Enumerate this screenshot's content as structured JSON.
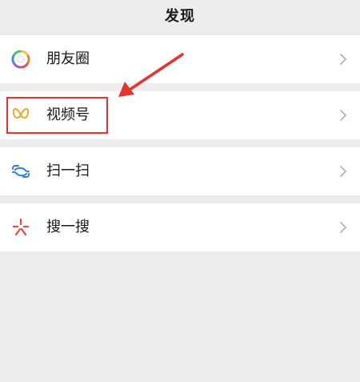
{
  "header": {
    "title": "发现"
  },
  "menu": {
    "items": [
      {
        "label": "朋友圈",
        "icon": "moments-icon"
      },
      {
        "label": "视频号",
        "icon": "channels-icon"
      },
      {
        "label": "扫一扫",
        "icon": "scan-icon"
      },
      {
        "label": "搜一搜",
        "icon": "search-icon"
      }
    ]
  },
  "colors": {
    "background": "#ededed",
    "cell": "#ffffff",
    "text": "#191919",
    "chevron": "#b2b2b2",
    "annotation": "#e8322f",
    "channels_icon": "#f0a535",
    "scan_icon": "#2f7fd9",
    "search_icon": "#e04b45"
  }
}
